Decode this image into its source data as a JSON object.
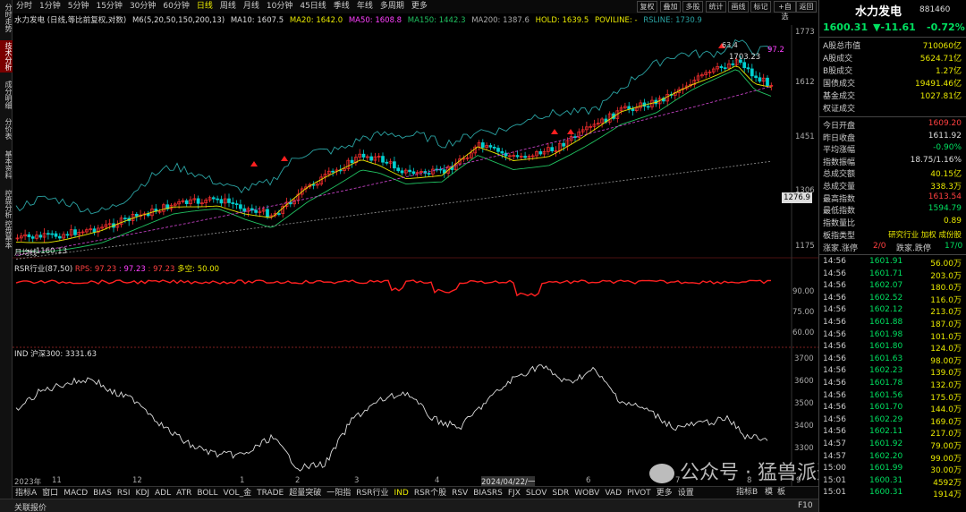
{
  "left_tabs": [
    "分时走势",
    "技术分析",
    "成分明细",
    "分价表",
    "基本资料",
    "控盘分析",
    "控盘基本"
  ],
  "periods": [
    "分时",
    "1分钟",
    "5分钟",
    "15分钟",
    "30分钟",
    "60分钟",
    "日线",
    "周线",
    "月线",
    "10分钟",
    "45日线",
    "季线",
    "年线",
    "多周期",
    "更多"
  ],
  "period_active": "日线",
  "right_tools": [
    "复权",
    "叠加",
    "多股",
    "统计",
    "画线",
    "标记",
    "+自选",
    "返回"
  ],
  "chart_title": "水力发电 (日线,等比前复权,对数)",
  "ma_legend": {
    "m6": "M6(5,20,50,150,200,13)",
    "ma10": "MA10: 1607.5",
    "ma20": "MA20: 1642.0",
    "ma50": "MA50: 1608.8",
    "ma150": "MA150: 1442.3",
    "ma200": "MA200: 1387.6",
    "hold": "HOLD: 1639.5",
    "poviline": "POVILINE: -",
    "rsline": "RSLINE: 1730.9"
  },
  "main_axis": [
    "1773",
    "1612",
    "1451",
    "1306",
    "1175"
  ],
  "last_price_tag": "1276.9",
  "annotations": {
    "high": "63.4",
    "price": "1703.23",
    "rs": "97.2",
    "low": "← 1160.13",
    "ma_label": "月均线"
  },
  "rsr_legend": {
    "name": "RSR行业(87,50)",
    "rps": "RPS: 97.23",
    "v1": ": 97.23",
    "v2": ": 97.23",
    "v3": "多空: 50.00"
  },
  "rsr_axis": [
    "90.00",
    "75.00",
    "60.00"
  ],
  "ind_legend": {
    "name": "IND 沪深300: 3331.63"
  },
  "ind_axis": [
    "3700",
    "3600",
    "3500",
    "3400",
    "3300"
  ],
  "time_axis": [
    "2023年",
    "11",
    "12",
    "1",
    "2",
    "3",
    "4",
    "2024/04/22/一",
    "6",
    "7",
    "8",
    "9"
  ],
  "bottom_tabs": [
    "指标A",
    "窗口",
    "MACD",
    "BIAS",
    "RSI",
    "KDJ",
    "ADL",
    "ATR",
    "BOLL",
    "VOL_金",
    "TRADE",
    "超量突破",
    "一阳指",
    "RSR行业",
    "IND",
    "RSR个股",
    "RSV",
    "BIASRS",
    "FJX",
    "SLOV",
    "SDR",
    "WOBV",
    "VAD",
    "PIVOT",
    "更多",
    "设置"
  ],
  "bottom_active": "IND",
  "bottom_right": [
    "指标B",
    "模",
    "板"
  ],
  "status_text": "关联报价",
  "status_right": "F10",
  "quote": {
    "name": "水力发电",
    "code": "881460",
    "price": "1600.31",
    "change": "▼-11.61",
    "pct": "-0.72%"
  },
  "stats_top": [
    {
      "k": "A股总市值",
      "v": "710060亿"
    },
    {
      "k": "A股成交",
      "v": "5624.71亿"
    },
    {
      "k": "B股成交",
      "v": "1.27亿"
    },
    {
      "k": "国债成交",
      "v": "19491.46亿"
    },
    {
      "k": "基金成交",
      "v": "1027.81亿"
    },
    {
      "k": "权证成交",
      "v": ""
    }
  ],
  "stats": [
    {
      "k": "今日开盘",
      "v": "1609.20",
      "c": "#ff4040"
    },
    {
      "k": "昨日收盘",
      "v": "1611.92",
      "c": "#dddddd"
    },
    {
      "k": "平均涨幅",
      "v": "-0.90%",
      "c": "#00e060"
    },
    {
      "k": "指数振幅",
      "v": "18.75/1.16%",
      "c": "#dddddd"
    },
    {
      "k": "总成交额",
      "v": "40.15亿",
      "c": "#e8e800"
    },
    {
      "k": "总成交量",
      "v": "338.3万",
      "c": "#e8e800"
    },
    {
      "k": "最高指数",
      "v": "1613.54",
      "c": "#ff4040"
    },
    {
      "k": "最低指数",
      "v": "1594.79",
      "c": "#00e060"
    },
    {
      "k": "指数量比",
      "v": "0.89",
      "c": "#e8e800"
    }
  ],
  "board_type": {
    "k": "板指类型",
    "v": "研究行业 加权 成份股"
  },
  "updown": {
    "k1": "涨家.涨停",
    "v1": "2/0",
    "k2": "跌家.跌停",
    "v2": "17/0"
  },
  "ticks": [
    {
      "t": "14:56",
      "p": "1601.91",
      "v": "56.00万"
    },
    {
      "t": "14:56",
      "p": "1601.71",
      "v": "203.0万"
    },
    {
      "t": "14:56",
      "p": "1602.07",
      "v": "180.0万"
    },
    {
      "t": "14:56",
      "p": "1602.52",
      "v": "116.0万"
    },
    {
      "t": "14:56",
      "p": "1602.12",
      "v": "213.0万"
    },
    {
      "t": "14:56",
      "p": "1601.88",
      "v": "187.0万"
    },
    {
      "t": "14:56",
      "p": "1601.98",
      "v": "101.0万"
    },
    {
      "t": "14:56",
      "p": "1601.80",
      "v": "124.0万"
    },
    {
      "t": "14:56",
      "p": "1601.63",
      "v": "98.00万"
    },
    {
      "t": "14:56",
      "p": "1602.23",
      "v": "139.0万"
    },
    {
      "t": "14:56",
      "p": "1601.78",
      "v": "132.0万"
    },
    {
      "t": "14:56",
      "p": "1601.56",
      "v": "175.0万"
    },
    {
      "t": "14:56",
      "p": "1601.70",
      "v": "144.0万"
    },
    {
      "t": "14:56",
      "p": "1602.29",
      "v": "169.0万"
    },
    {
      "t": "14:56",
      "p": "1602.11",
      "v": "217.0万"
    },
    {
      "t": "14:57",
      "p": "1601.92",
      "v": "79.00万"
    },
    {
      "t": "14:57",
      "p": "1602.20",
      "v": "99.00万"
    },
    {
      "t": "15:00",
      "p": "1601.99",
      "v": "30.00万"
    },
    {
      "t": "15:01",
      "p": "1600.31",
      "v": "4592万"
    },
    {
      "t": "15:01",
      "p": "1600.31",
      "v": "1914万"
    }
  ],
  "watermark": "公众号 · 猛兽派选股",
  "colors": {
    "up": "#ff3030",
    "down": "#00d0d0",
    "fall": "#00e060",
    "bg": "#000000",
    "accent": "#e8e800"
  }
}
